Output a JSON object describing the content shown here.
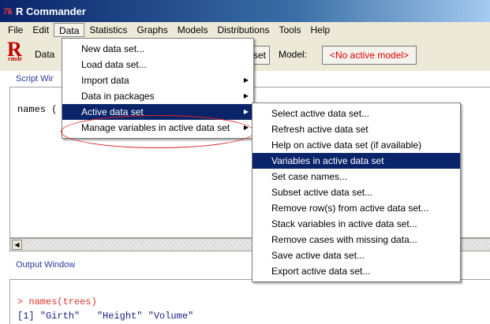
{
  "window": {
    "title": "R Commander",
    "logo_text": "7k"
  },
  "menubar": [
    "File",
    "Edit",
    "Data",
    "Statistics",
    "Graphs",
    "Models",
    "Distributions",
    "Tools",
    "Help"
  ],
  "toolbar": {
    "r_logo_big": "R",
    "r_logo_small": "cmdr",
    "data_label": "Data",
    "dataset_button": "set",
    "model_label": "Model:",
    "model_value": "<No active model>"
  },
  "script": {
    "label": "Script Wir",
    "text": "names ("
  },
  "output": {
    "label": "Output Window",
    "command": "> names(trees)",
    "result": "[1] \"Girth\"   \"Height\" \"Volume\""
  },
  "data_menu": {
    "items": [
      {
        "label": "New data set...",
        "submenu": false
      },
      {
        "label": "Load data set...",
        "submenu": false
      },
      {
        "label": "Import data",
        "submenu": true
      },
      {
        "label": "Data in packages",
        "submenu": true
      },
      {
        "label": "Active data set",
        "submenu": true,
        "highlighted": true
      },
      {
        "label": "Manage variables in active data set",
        "submenu": true
      }
    ]
  },
  "active_menu": {
    "items": [
      {
        "label": "Select active data set..."
      },
      {
        "label": "Refresh active data set"
      },
      {
        "label": "Help on active data set (if available)"
      },
      {
        "label": "Variables in active data set",
        "highlighted": true
      },
      {
        "label": "Set case names..."
      },
      {
        "label": "Subset active data set..."
      },
      {
        "label": "Remove row(s) from active data set..."
      },
      {
        "label": "Stack variables in active data set..."
      },
      {
        "label": "Remove cases with missing data..."
      },
      {
        "label": "Save active data set..."
      },
      {
        "label": "Export active data set..."
      }
    ]
  },
  "colors": {
    "highlight": "#0a246a",
    "annotation": "#e02020",
    "model_text": "#e00000"
  }
}
